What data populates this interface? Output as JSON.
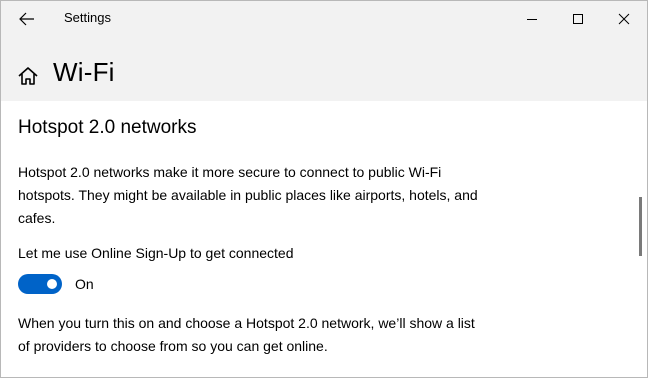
{
  "titlebar": {
    "app_title": "Settings",
    "icons": {
      "back": "back-arrow-icon",
      "minimize": "minimize-icon",
      "maximize": "maximize-icon",
      "close": "close-icon"
    }
  },
  "header": {
    "title": "Wi-Fi",
    "icon": "home-icon"
  },
  "section": {
    "title": "Hotspot 2.0 networks",
    "description": "Hotspot 2.0 networks make it more secure to connect to public Wi-Fi hotspots. They might be available in public places like airports, hotels, and cafes.",
    "toggle_label": "Let me use Online Sign-Up to get connected",
    "toggle_state": "On",
    "toggle_on": true,
    "info": "When you turn this on and choose a Hotspot 2.0 network, we’ll show a list of providers to choose from so you can get online."
  },
  "colors": {
    "accent": "#0063c8",
    "chrome_background": "#f2f2f2",
    "content_background": "#ffffff"
  }
}
